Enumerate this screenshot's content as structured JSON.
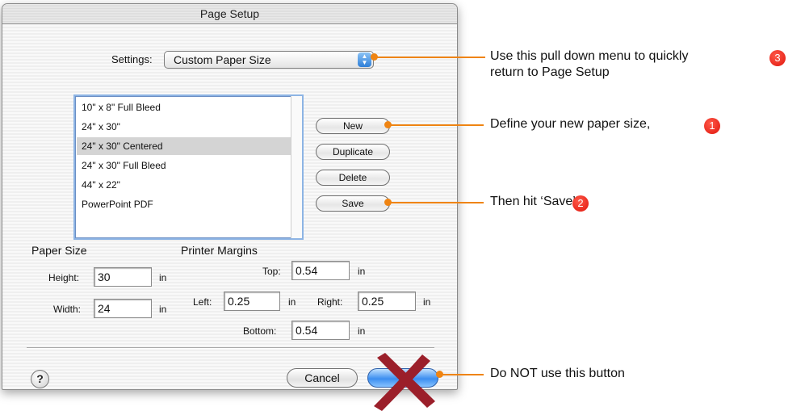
{
  "window": {
    "title": "Page Setup"
  },
  "settings": {
    "label": "Settings:",
    "value": "Custom Paper Size"
  },
  "paper_list": {
    "items": [
      "10\" x 8\" Full Bleed",
      "24\" x 30\"",
      "24\" x 30\" Centered",
      "24\" x 30\" Full Bleed",
      "44\" x 22\"",
      "PowerPoint PDF"
    ],
    "selected_index": 2
  },
  "buttons": {
    "new": "New",
    "duplicate": "Duplicate",
    "delete": "Delete",
    "save": "Save",
    "cancel": "Cancel"
  },
  "paper_size": {
    "heading": "Paper Size",
    "height_label": "Height:",
    "height_value": "30",
    "height_unit": "in",
    "width_label": "Width:",
    "width_value": "24",
    "width_unit": "in"
  },
  "margins": {
    "heading": "Printer Margins",
    "top_label": "Top:",
    "top_value": "0.54",
    "left_label": "Left:",
    "left_value": "0.25",
    "right_label": "Right:",
    "right_value": "0.25",
    "bottom_label": "Bottom:",
    "bottom_value": "0.54",
    "unit": "in"
  },
  "help": {
    "label": "?"
  },
  "callouts": {
    "menu_line1": "Use this pull down menu to quickly",
    "menu_line2": "return to Page Setup",
    "menu_badge": "3",
    "new": "Define your new paper size,",
    "new_badge": "1",
    "save": "Then hit ‘Save’.",
    "save_badge": "2",
    "ok": "Do NOT use this button"
  },
  "colors": {
    "callout_line": "#ef8412",
    "badge": "#e0150c",
    "cross": "#9b1f2a",
    "default_button": "#3c8ef0"
  }
}
